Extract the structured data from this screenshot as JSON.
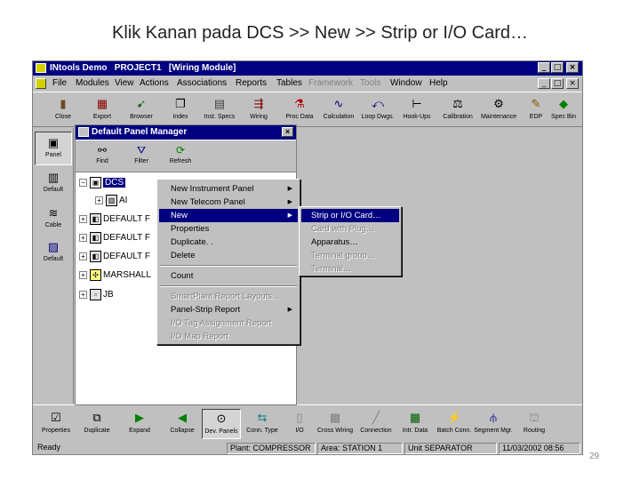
{
  "slide": {
    "title": "Klik Kanan pada DCS  >> New >> Strip or I/O Card…",
    "page_number": "29"
  },
  "window": {
    "title": "INtools Demo   PROJECT1   [Wiring Module]",
    "controls": [
      "_",
      "□",
      "×"
    ],
    "doc_controls": [
      "_",
      "□",
      "×"
    ]
  },
  "menubar": {
    "items": [
      "File",
      "Modules",
      "View",
      "Actions",
      "Associations",
      "Reports",
      "Tables",
      "Framework",
      "Tools",
      "Window",
      "Help"
    ]
  },
  "toolbar": {
    "buttons": [
      {
        "label": "Close",
        "icon": "close-door-icon"
      },
      {
        "label": "Export",
        "icon": "export-icon"
      },
      {
        "label": "Browser",
        "icon": "browser-icon"
      },
      {
        "label": "Index",
        "icon": "index-icon"
      },
      {
        "label": "Inst. Specs",
        "icon": "instrument-specs-icon"
      },
      {
        "label": "Wiring",
        "icon": "wiring-icon"
      },
      {
        "label": "Proc Data",
        "icon": "process-data-icon"
      },
      {
        "label": "Calculation",
        "icon": "calculation-icon"
      },
      {
        "label": "Loop Dwgs.",
        "icon": "loop-drawings-icon"
      },
      {
        "label": "Hook-Ups",
        "icon": "hook-ups-icon"
      },
      {
        "label": "Calibration",
        "icon": "calibration-icon"
      },
      {
        "label": "Maintenance",
        "icon": "maintenance-icon"
      },
      {
        "label": "EDP",
        "icon": "edp-icon"
      },
      {
        "label": "Spec Bin",
        "icon": "spec-bin-icon"
      }
    ]
  },
  "leftbar": {
    "items": [
      {
        "label": "Panel",
        "icon": "panel-icon"
      },
      {
        "label": "Default",
        "icon": "default-panel-icon"
      },
      {
        "label": "Cable",
        "icon": "cable-icon"
      },
      {
        "label": "Default",
        "icon": "default-cable-icon"
      }
    ]
  },
  "panel_manager": {
    "title": "Default Panel Manager",
    "tools": [
      {
        "label": "Find",
        "icon": "binoculars-icon"
      },
      {
        "label": "Filter",
        "icon": "filter-icon"
      },
      {
        "label": "Refresh",
        "icon": "refresh-icon"
      }
    ],
    "tree": [
      {
        "label": "DCS",
        "expander": "−",
        "selected": true
      },
      {
        "label": "AI",
        "expander": "+",
        "selected": false
      },
      {
        "label": "DEFAULT F",
        "expander": "+",
        "selected": false
      },
      {
        "label": "DEFAULT F",
        "expander": "+",
        "selected": false
      },
      {
        "label": "DEFAULT F",
        "expander": "+",
        "selected": false
      },
      {
        "label": "MARSHALL",
        "expander": "+",
        "selected": false
      },
      {
        "label": "JB",
        "expander": "+",
        "selected": false
      }
    ]
  },
  "context_menu": {
    "items": [
      {
        "label": "New Instrument Panel",
        "submenu": true
      },
      {
        "label": "New Telecom Panel",
        "submenu": true
      },
      {
        "label": "New",
        "submenu": true,
        "highlighted": true
      },
      {
        "label": "Properties"
      },
      {
        "label": "Duplicate. ."
      },
      {
        "label": "Delete"
      },
      {
        "label": "Count"
      },
      {
        "label": "SmartPlant Report Layouts. .",
        "disabled": true
      },
      {
        "label": "Panel-Strip Report",
        "submenu": true
      },
      {
        "label": "I/O Tag Assignment Report",
        "disabled": true
      },
      {
        "label": "I/O Map Report",
        "disabled": true
      }
    ],
    "arrow": "▶"
  },
  "submenu": {
    "items": [
      {
        "label": "Strip or I/O Card…",
        "highlighted": true
      },
      {
        "label": "Card with Plug…",
        "disabled": true
      },
      {
        "label": "Apparatus…"
      },
      {
        "label": "Terminal group…",
        "disabled": true
      },
      {
        "label": "Terminal…",
        "disabled": true
      }
    ]
  },
  "bottom_toolbar": {
    "buttons": [
      {
        "label": "Properties",
        "icon": "properties-icon"
      },
      {
        "label": "Duplicate",
        "icon": "duplicate-icon"
      },
      {
        "label": "Expand",
        "icon": "expand-icon"
      },
      {
        "label": "Collapse",
        "icon": "collapse-icon"
      },
      {
        "label": "Dev. Panels",
        "icon": "device-panels-icon"
      },
      {
        "label": "Conn. Type",
        "icon": "connection-type-icon"
      },
      {
        "label": "I/O",
        "icon": "io-icon"
      },
      {
        "label": "Cross Wiring",
        "icon": "cross-wiring-icon"
      },
      {
        "label": "Connection",
        "icon": "connection-icon"
      },
      {
        "label": "Intr. Data",
        "icon": "interface-data-icon"
      },
      {
        "label": "Batch Conn.",
        "icon": "batch-connection-icon"
      },
      {
        "label": "Segment Mgr.",
        "icon": "segment-manager-icon"
      },
      {
        "label": "Routing",
        "icon": "routing-icon"
      }
    ]
  },
  "statusbar": {
    "status": "Ready",
    "plant": "Plant: COMPRESSOR",
    "area": "Area: STATION 1",
    "unit": "Unit SEPARATOR",
    "datetime": "11/03/2002  08:56"
  },
  "colors": {
    "titlebar": "#000080",
    "menu_highlight": "#000080",
    "face": "#c0c0c0"
  }
}
